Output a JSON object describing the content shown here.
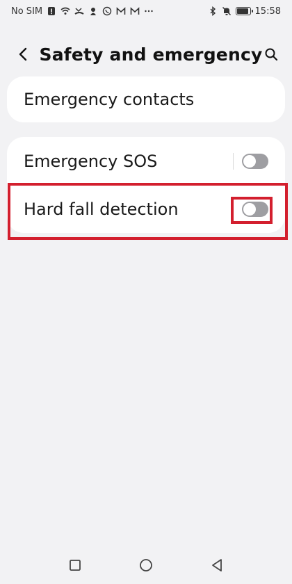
{
  "status_bar": {
    "carrier": "No SIM",
    "time": "15:58",
    "icons": [
      "sim-alert-icon",
      "wifi-icon",
      "missed-call-icon",
      "location-icon",
      "whatsapp-icon",
      "gmail-icon",
      "gmail-icon",
      "more-dots-icon",
      "bluetooth-icon",
      "mute-icon",
      "battery-icon"
    ]
  },
  "header": {
    "title": "Safety and emergency",
    "back_icon": "chevron-left-icon",
    "search_icon": "search-icon"
  },
  "sections": {
    "contacts": {
      "label": "Emergency contacts"
    },
    "emergency": [
      {
        "label": "Emergency SOS",
        "toggle": false
      },
      {
        "label": "Hard fall detection",
        "toggle": false
      }
    ]
  },
  "colors": {
    "background": "#f2f2f4",
    "card": "#ffffff",
    "toggle_off": "#9e9ea2",
    "highlight": "#d31f2e"
  },
  "nav_bar": {
    "buttons": [
      "recents-icon",
      "home-icon",
      "back-icon"
    ]
  }
}
